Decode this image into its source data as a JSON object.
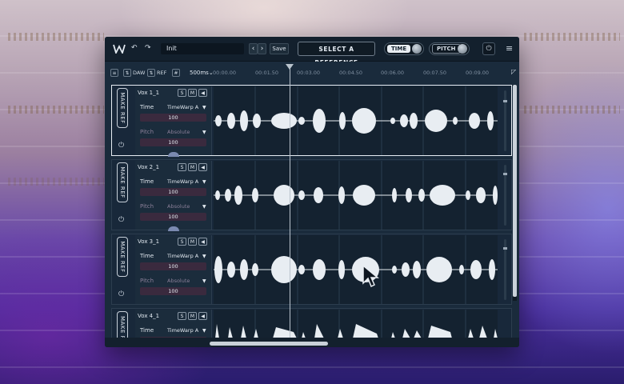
{
  "toolbar": {
    "preset_name": "Init",
    "prev_symbol": "‹",
    "next_symbol": "›",
    "save_label": "Save",
    "select_reference_label": "SELECT A REFERENCE",
    "time_label": "TIME",
    "pitch_label": "PITCH",
    "undo_symbol": "↶",
    "redo_symbol": "↷",
    "power_symbol": "⏻",
    "menu_symbol": "≡"
  },
  "timeline": {
    "daw_label": "DAW",
    "ref_label": "REF",
    "zoom_value": "500ms",
    "ticks": [
      "00:00.00",
      "00:01.50",
      "00:03.00",
      "00:04.50",
      "00:06.00",
      "00:07.50",
      "00:09.00"
    ]
  },
  "tracks": [
    {
      "name": "Vox 1_1",
      "time_label": "Time",
      "time_mode": "TimeWarp A",
      "time_value": "100",
      "pitch_label": "Pitch",
      "pitch_mode": "Absolute",
      "pitch_value": "100",
      "make_ref_label": "MAKE REF",
      "solo": "S",
      "mute": "M",
      "selected": true
    },
    {
      "name": "Vox 2_1",
      "time_label": "Time",
      "time_mode": "TimeWarp A",
      "time_value": "100",
      "pitch_label": "Pitch",
      "pitch_mode": "Absolute",
      "pitch_value": "100",
      "make_ref_label": "MAKE REF",
      "solo": "S",
      "mute": "M",
      "selected": false
    },
    {
      "name": "Vox 3_1",
      "time_label": "Time",
      "time_mode": "TimeWarp A",
      "time_value": "100",
      "pitch_label": "Pitch",
      "pitch_mode": "Absolute",
      "pitch_value": "100",
      "make_ref_label": "MAKE REF",
      "solo": "S",
      "mute": "M",
      "selected": false
    },
    {
      "name": "Vox 4_1",
      "time_label": "Time",
      "time_mode": "TimeWarp A",
      "time_value": "",
      "pitch_label": "",
      "pitch_mode": "",
      "pitch_value": "",
      "make_ref_label": "MAKE R",
      "solo": "S",
      "mute": "M",
      "selected": false
    }
  ],
  "colors": {
    "accent": "#e7edf3",
    "panel_bg": "#1a2b3c",
    "waveform": "#e8edf2",
    "pitch_text": "#8a7f98"
  }
}
